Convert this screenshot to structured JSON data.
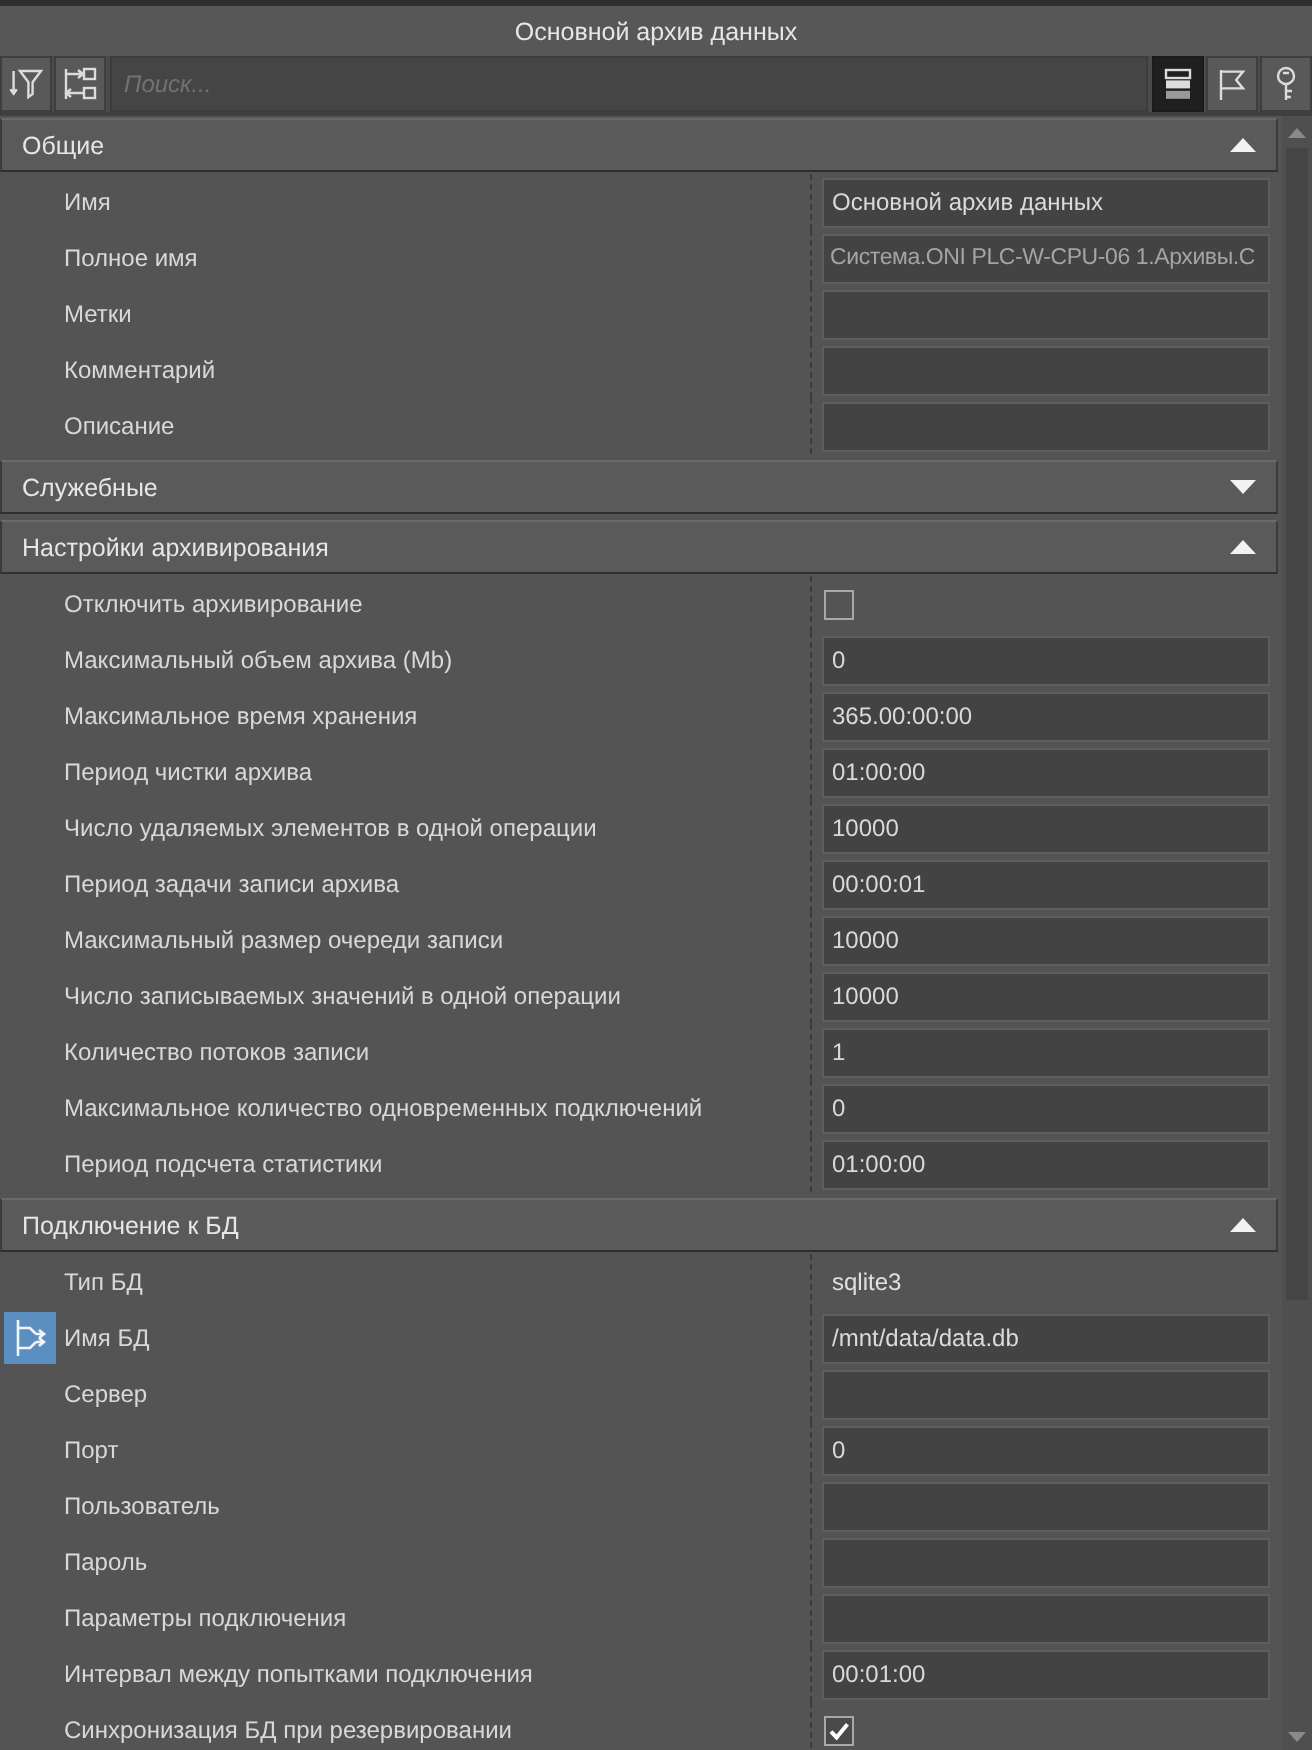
{
  "window": {
    "title": "Основной архив данных"
  },
  "toolbar": {
    "search": {
      "placeholder": "Поиск..."
    },
    "mode_buttons": [
      {
        "selected": true
      },
      {
        "selected": false
      },
      {
        "selected": false
      }
    ]
  },
  "sections": [
    {
      "title": "Общие",
      "expanded": true,
      "rows": [
        {
          "label": "Имя",
          "kind": "field",
          "value": "Основной архив данных",
          "linked": false
        },
        {
          "label": "Полное имя",
          "kind": "readonly",
          "value": "Система.ONI PLC-W-CPU-06 1.Архивы.С",
          "linked": false
        },
        {
          "label": "Метки",
          "kind": "field",
          "linked": false
        },
        {
          "label": "Комментарий",
          "kind": "field",
          "linked": false
        },
        {
          "label": "Описание",
          "kind": "field",
          "linked": false
        }
      ]
    },
    {
      "title": "Служебные",
      "expanded": false
    },
    {
      "title": "Настройки архивирования",
      "expanded": true,
      "rows": [
        {
          "label": "Отключить архивирование",
          "kind": "checkbox",
          "checked": false,
          "linked": false
        },
        {
          "label": "Максимальный объем архива (Mb)",
          "kind": "field",
          "value": "0",
          "linked": false
        },
        {
          "label": "Максимальное время хранения",
          "kind": "field",
          "value": "365.00:00:00",
          "linked": false
        },
        {
          "label": "Период чистки архива",
          "kind": "field",
          "value": "01:00:00",
          "linked": false
        },
        {
          "label": "Число удаляемых элементов в одной операции",
          "kind": "field",
          "value": "10000",
          "linked": false
        },
        {
          "label": "Период задачи записи архива",
          "kind": "field",
          "value": "00:00:01",
          "linked": false
        },
        {
          "label": "Максимальный размер очереди записи",
          "kind": "field",
          "value": "10000",
          "linked": false
        },
        {
          "label": "Число записываемых значений в одной операции",
          "kind": "field",
          "value": "10000",
          "linked": false
        },
        {
          "label": "Количество потоков записи",
          "kind": "field",
          "value": "1",
          "linked": false
        },
        {
          "label": "Максимальное количество одновременных подключений",
          "kind": "field",
          "value": "0",
          "linked": false
        },
        {
          "label": "Период подсчета статистики",
          "kind": "field",
          "value": "01:00:00",
          "linked": false
        }
      ]
    },
    {
      "title": "Подключение к БД",
      "expanded": true,
      "rows": [
        {
          "label": "Тип БД",
          "kind": "plain",
          "value": "sqlite3",
          "linked": false
        },
        {
          "label": "Имя БД",
          "kind": "field",
          "value": "/mnt/data/data.db",
          "linked": true
        },
        {
          "label": "Сервер",
          "kind": "field",
          "linked": false
        },
        {
          "label": "Порт",
          "kind": "field",
          "value": "0",
          "linked": false
        },
        {
          "label": "Пользователь",
          "kind": "field",
          "linked": false
        },
        {
          "label": "Пароль",
          "kind": "field",
          "linked": false
        },
        {
          "label": "Параметры подключения",
          "kind": "field",
          "linked": false
        },
        {
          "label": "Интервал между попытками подключения",
          "kind": "field",
          "value": "00:01:00",
          "linked": false
        },
        {
          "label": "Синхронизация БД при резервировании",
          "kind": "checkbox",
          "checked": true,
          "linked": false
        }
      ]
    }
  ]
}
